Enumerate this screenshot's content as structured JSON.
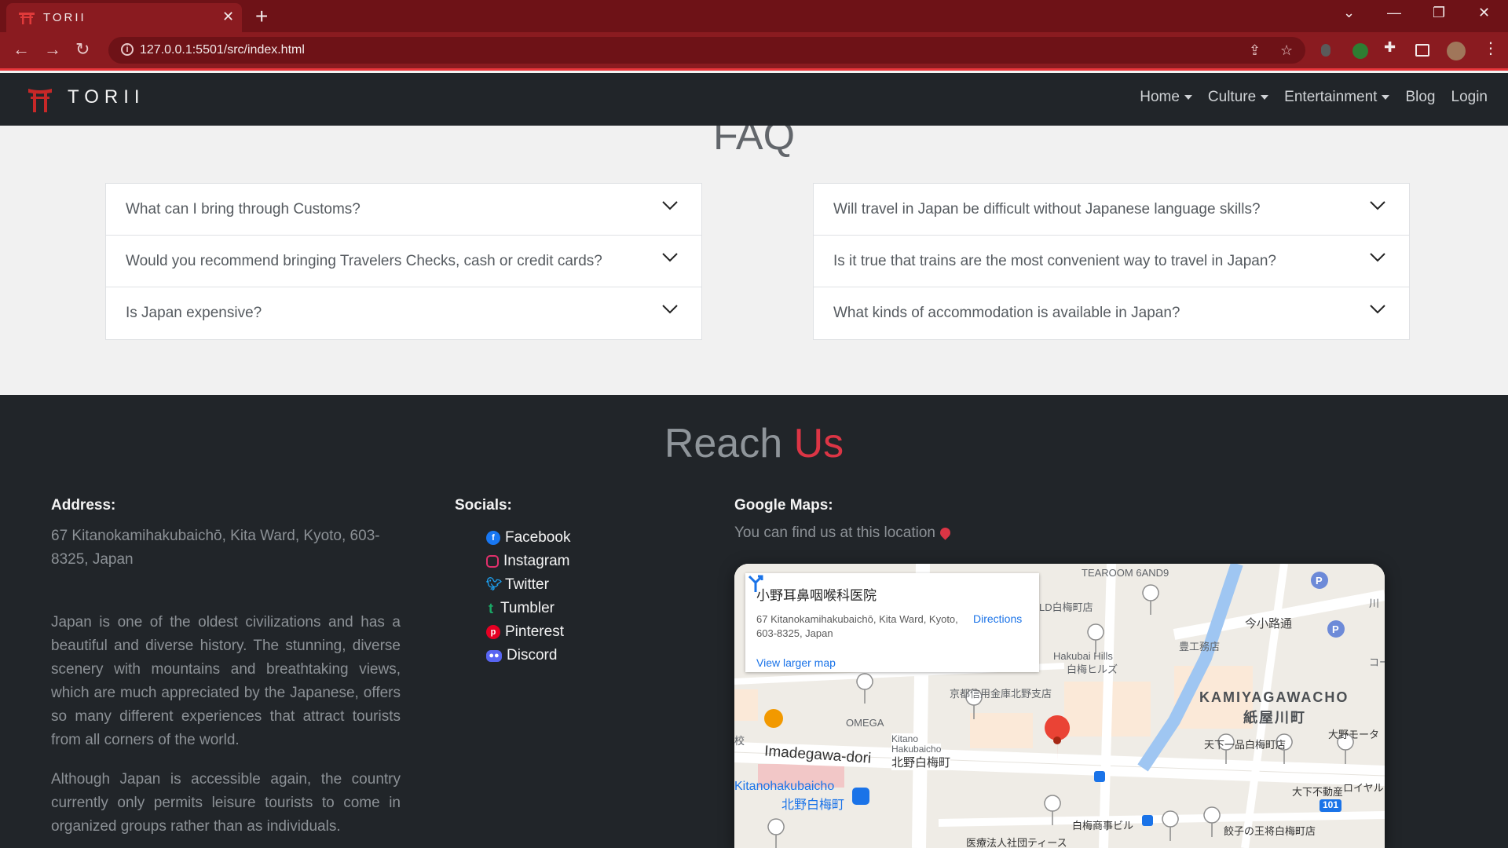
{
  "browser": {
    "tab_title": "TORII",
    "url": "127.0.0.1:5501/src/index.html"
  },
  "navbar": {
    "brand": "TORII",
    "links": [
      {
        "label": "Home",
        "dropdown": true
      },
      {
        "label": "Culture",
        "dropdown": true
      },
      {
        "label": "Entertainment",
        "dropdown": true
      },
      {
        "label": "Blog",
        "dropdown": false
      },
      {
        "label": "Login",
        "dropdown": false
      }
    ]
  },
  "faq": {
    "title": "FAQ",
    "left": [
      "What can I bring through Customs?",
      "Would you recommend bringing Travelers Checks, cash or credit cards?",
      "Is Japan expensive?"
    ],
    "right": [
      "Will travel in Japan be difficult without Japanese language skills?",
      "Is it true that trains are the most convenient way to travel in Japan?",
      "What kinds of accommodation is available in Japan?"
    ]
  },
  "footer": {
    "title_a": "Reach",
    "title_b": "Us",
    "address_heading": "Address:",
    "address": "67 Kitanokamihakubaichō, Kita Ward, Kyoto, 603-8325, Japan",
    "para1": "Japan is one of the oldest civilizations and has a beautiful and diverse history. The stunning, diverse scenery with mountains and breathtaking views, which are much appreciated by the Japanese, offers so many different experiences that attract tourists from all corners of the world.",
    "para2": "Although Japan is accessible again, the country currently only permits leisure tourists to come in organized groups rather than as individuals.",
    "socials_heading": "Socials:",
    "socials": [
      {
        "label": "Facebook",
        "icon": "facebook-icon",
        "color": "#1877f2"
      },
      {
        "label": "Instagram",
        "icon": "instagram-icon",
        "color": "#e1306c"
      },
      {
        "label": "Twitter",
        "icon": "twitter-icon",
        "color": "#1da1f2"
      },
      {
        "label": "Tumbler",
        "icon": "tumblr-icon",
        "color": "#1aa866"
      },
      {
        "label": "Pinterest",
        "icon": "pinterest-icon",
        "color": "#e60023"
      },
      {
        "label": "Discord",
        "icon": "discord-icon",
        "color": "#5865f2"
      }
    ],
    "maps_heading": "Google Maps:",
    "maps_sub": "You can find us at this location"
  },
  "map": {
    "place_name": "小野耳鼻咽喉科医院",
    "place_address": "67 Kitanokamihakubaichō, Kita Ward, Kyoto, 603-8325, Japan",
    "directions": "Directions",
    "larger_map": "View larger map",
    "labels": {
      "tearoom": "TEAROOM 6AND9",
      "d_shiraume": "LD白梅町店",
      "imakoji": "今小路通",
      "kawa": "川",
      "hakubai_hills": "Hakubai Hills",
      "hakubai_hills_jp": "白梅ヒルズ",
      "toko": "豊工務店",
      "co": "コー",
      "kamiya_en": "KAMIYAGAWACHO",
      "kamiya_jp": "紙屋川町",
      "omega": "OMEGA",
      "shinkin": "京都信用金庫北野支店",
      "kou": "校",
      "kitano1": "Kitano",
      "kitano2": "Hakubaicho",
      "kitano3": "北野白梅町",
      "imadegawa": "Imadegawa-dori",
      "station_en": "Kitanohakubaicho",
      "station_jp": "北野白梅町",
      "tenka": "天下一品白梅町店",
      "ohno": "大野モータ",
      "daika": "大下不動産",
      "royal": "ロイヤルメ",
      "route": "101",
      "shobo": "白梅商事ビル",
      "gyoza": "餃子の王将白梅町店",
      "iryo": "医療法人社団ティース"
    }
  }
}
